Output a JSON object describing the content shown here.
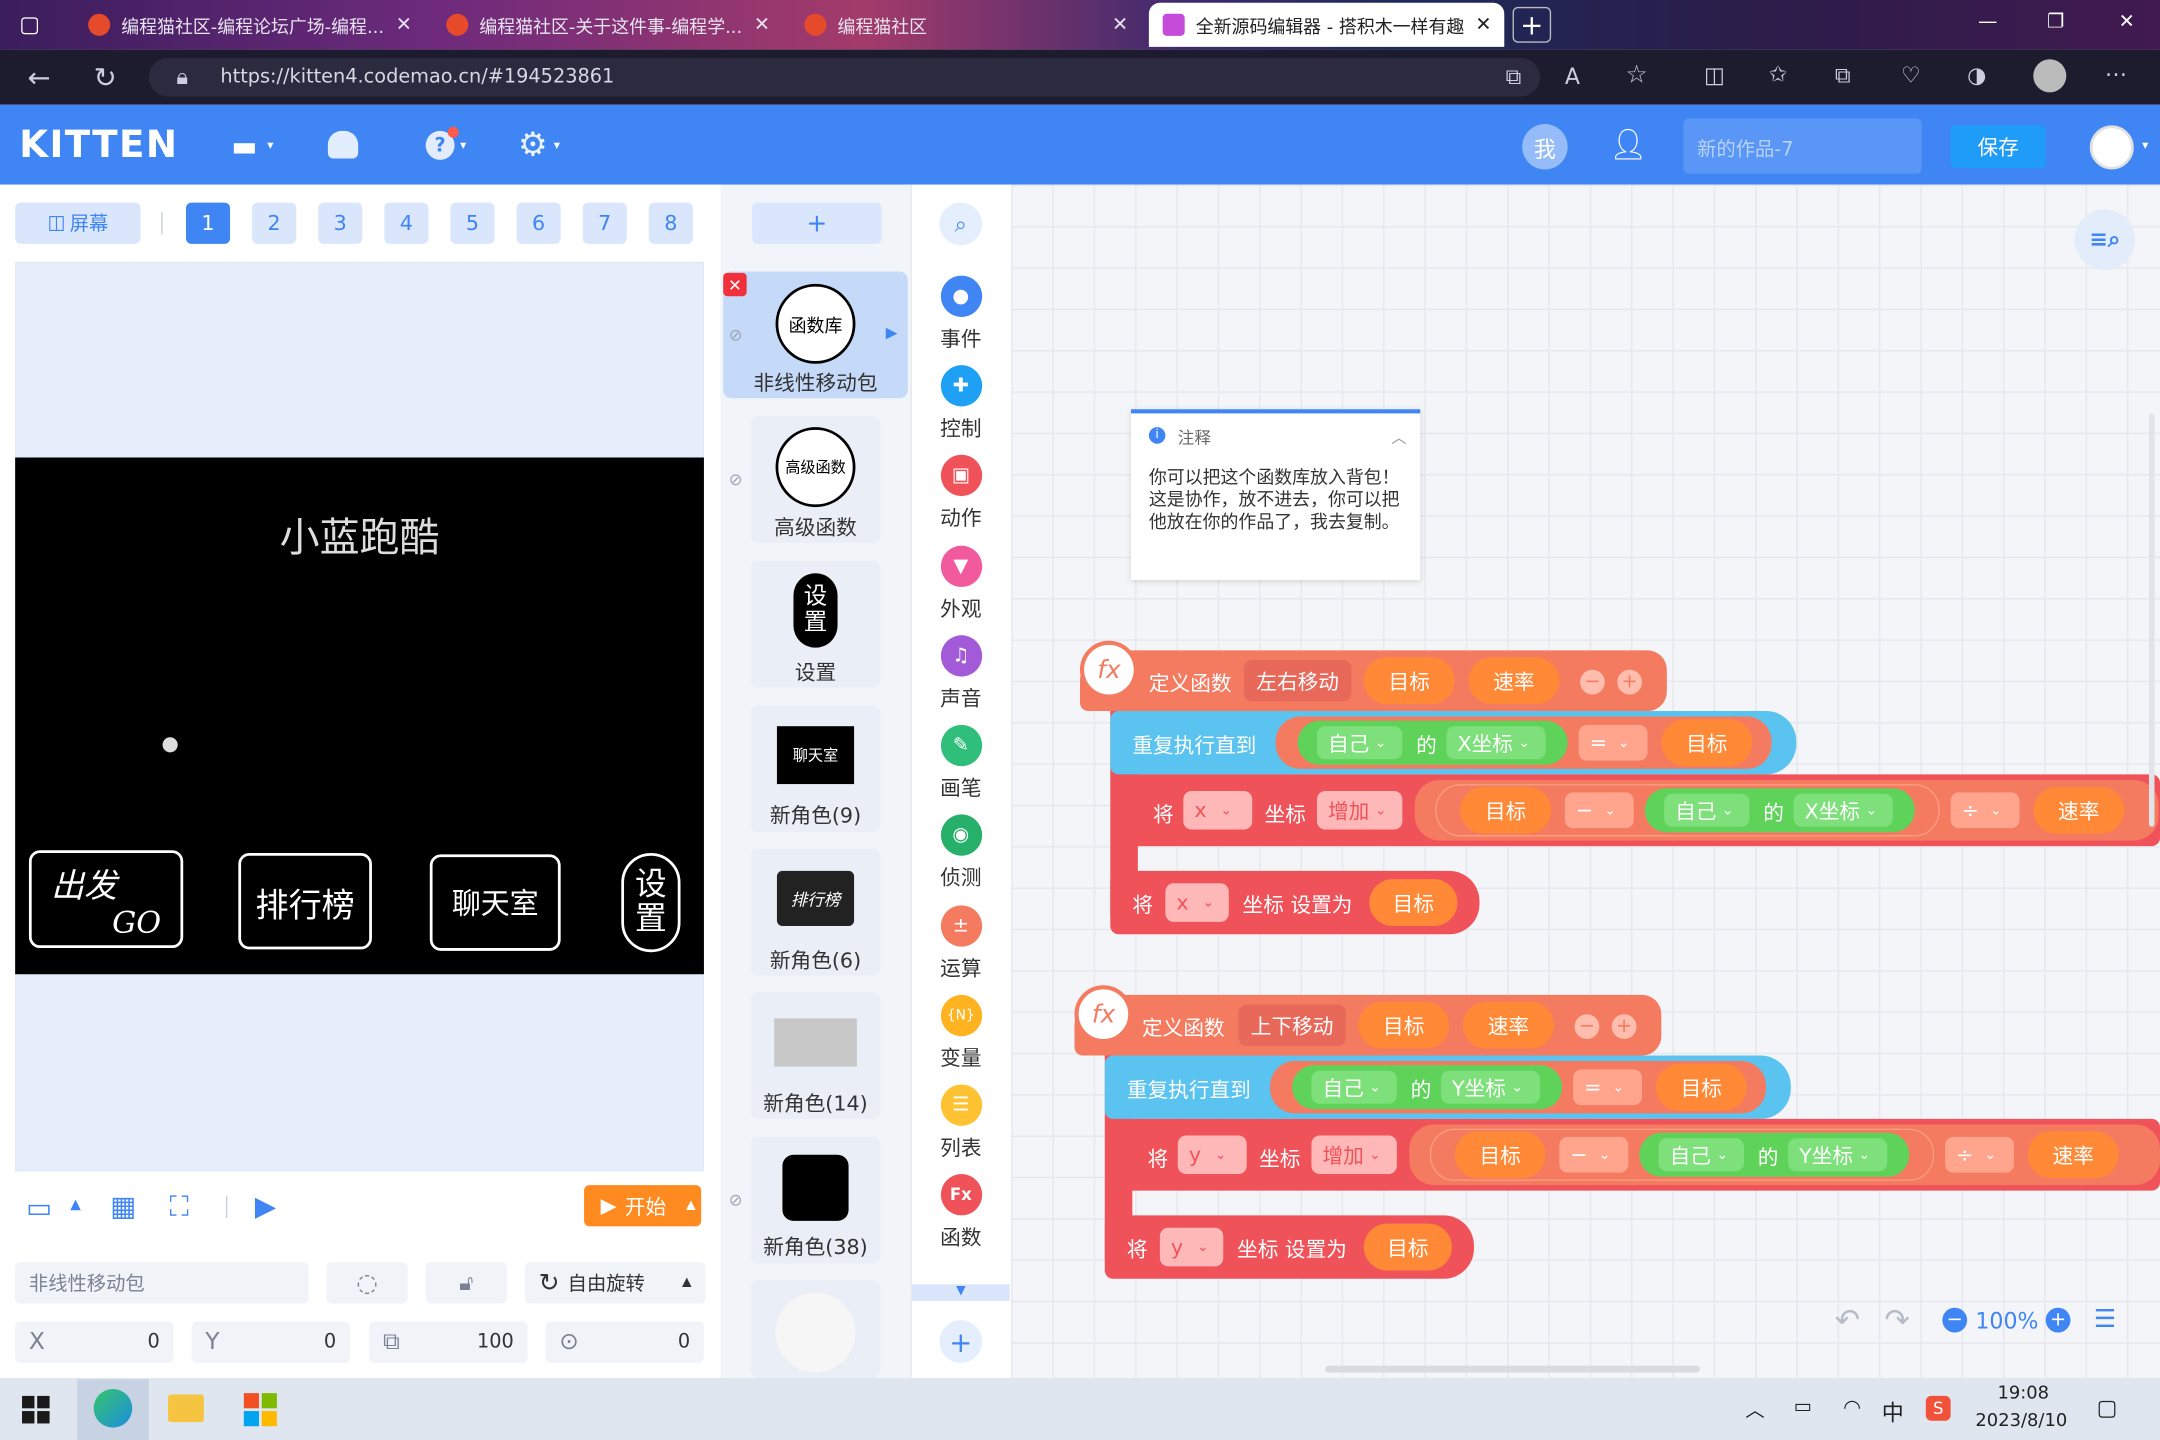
{
  "browser": {
    "tabs": [
      {
        "title": "编程猫社区-编程论坛广场-编程..."
      },
      {
        "title": "编程猫社区-关于这件事-编程学..."
      },
      {
        "title": "编程猫社区"
      },
      {
        "title": "全新源码编辑器 - 搭积木一样有趣"
      }
    ],
    "url": "https://kitten4.codemao.cn/#194523861"
  },
  "header": {
    "logo": "KITTEN",
    "me_label": "我",
    "project_name_placeholder": "新的作品-7",
    "save_label": "保存"
  },
  "left": {
    "screen_label": "屏幕",
    "pages": [
      "1",
      "2",
      "3",
      "4",
      "5",
      "6",
      "7",
      "8"
    ],
    "active_page": "1",
    "stage": {
      "title": "小蓝跑酷",
      "btn_go_line1": "出发",
      "btn_go_line2": "GO",
      "btn_rank": "排行榜",
      "btn_chat": "聊天室",
      "btn_set_line1": "设",
      "btn_set_line2": "置"
    },
    "start_label": "开始",
    "sprite_name": "非线性移动包",
    "rotate_label": "自由旋转",
    "x_label": "X",
    "x_value": "0",
    "y_label": "Y",
    "y_value": "0",
    "size_value": "100",
    "dir_value": "0"
  },
  "sprites": {
    "add_label": "+",
    "items": [
      {
        "name": "非线性移动包",
        "thumb": "函数库"
      },
      {
        "name": "高级函数",
        "thumb": "高级函数"
      },
      {
        "name": "设置",
        "thumb_line1": "设",
        "thumb_line2": "置"
      },
      {
        "name": "新角色(9)",
        "thumb": "聊天室"
      },
      {
        "name": "新角色(6)",
        "thumb": "排行榜"
      },
      {
        "name": "新角色(14)"
      },
      {
        "name": "新角色(38)"
      }
    ]
  },
  "categories": [
    {
      "label": "事件",
      "color": "#3f85f3",
      "icon": "toggle-icon"
    },
    {
      "label": "控制",
      "color": "#1ea1f5",
      "icon": "gamepad-icon"
    },
    {
      "label": "动作",
      "color": "#f0525a",
      "icon": "robot-icon"
    },
    {
      "label": "外观",
      "color": "#f25a9e",
      "icon": "shirt-icon"
    },
    {
      "label": "声音",
      "color": "#a35ad8",
      "icon": "music-icon"
    },
    {
      "label": "画笔",
      "color": "#2fbf7a",
      "icon": "pen-icon"
    },
    {
      "label": "侦测",
      "color": "#27b06a",
      "icon": "radar-icon"
    },
    {
      "label": "运算",
      "color": "#f47a60",
      "icon": "calc-icon"
    },
    {
      "label": "变量",
      "color": "#ffb321",
      "icon": "variable-icon"
    },
    {
      "label": "列表",
      "color": "#ffc233",
      "icon": "list-icon"
    },
    {
      "label": "函数",
      "color": "#f0525a",
      "icon": "function-icon"
    }
  ],
  "note": {
    "title": "注释",
    "text": "你可以把这个函数库放入背包！这是协作，放不进去，你可以把他放在你的作品了，我去复制。"
  },
  "blocks": {
    "def_label": "定义函数",
    "func1_name": "左右移动",
    "func2_name": "上下移动",
    "param_target": "目标",
    "param_speed": "速率",
    "repeat_until": "重复执行直到",
    "self": "自己",
    "of": "的",
    "x_coord": "X坐标",
    "y_coord": "Y坐标",
    "eq": "=",
    "set_prefix": "将",
    "axis_x": "x",
    "axis_y": "y",
    "coord": "坐标",
    "increase": "增加",
    "minus": "−",
    "divide": "÷",
    "set_to": "坐标 设置为"
  },
  "zoom": "100%",
  "taskbar": {
    "time": "19:08",
    "date": "2023/8/10",
    "ime": "中"
  }
}
